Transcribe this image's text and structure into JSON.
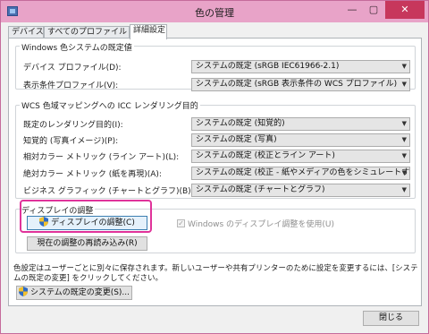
{
  "window": {
    "title": "色の管理",
    "close_label": "✕",
    "minimize_label": "—",
    "maximize_label": "▢"
  },
  "tabs": [
    {
      "label": "デバイス"
    },
    {
      "label": "すべてのプロファイル"
    },
    {
      "label": "詳細設定"
    }
  ],
  "windows_defaults": {
    "heading": "Windows 色システムの既定値",
    "rows": [
      {
        "label": "デバイス プロファイル(D):",
        "value": "システムの既定 (sRGB IEC61966-2.1)"
      },
      {
        "label": "表示条件プロファイル(V):",
        "value": "システムの既定 (sRGB 表示条件の WCS プロファイル)"
      }
    ]
  },
  "icc_mapping": {
    "heading": "WCS 色域マッピングへの ICC レンダリング目的",
    "rows": [
      {
        "label": "既定のレンダリング目的(I):",
        "value": "システムの既定 (知覚的)"
      },
      {
        "label": "知覚的 (写真イメージ)(P):",
        "value": "システムの既定 (写真)"
      },
      {
        "label": "相対カラー メトリック (ライン アート)(L):",
        "value": "システムの既定 (校正とライン アート)"
      },
      {
        "label": "絶対カラー メトリック (紙を再現)(A):",
        "value": "システムの既定 (校正 - 紙やメディアの色をシミュレートする)"
      },
      {
        "label": "ビジネス グラフィック (チャートとグラフ)(B):",
        "value": "システムの既定 (チャートとグラフ)"
      }
    ]
  },
  "display_calibration": {
    "heading": "ディスプレイの調整",
    "calibrate_label": "ディスプレイの調整(C)",
    "reload_label": "現在の調整の再読み込み(R)",
    "checkbox_label": "Windows のディスプレイ調整を使用(U)",
    "checkbox_checked": true
  },
  "note": "色設定はユーザーごとに別々に保存されます。新しいユーザーや共有プリンターのために設定を変更するには、[システムの既定の変更] をクリックしてください。",
  "change_defaults_label": "システムの既定の変更(S)...",
  "close_button_label": "閉じる"
}
